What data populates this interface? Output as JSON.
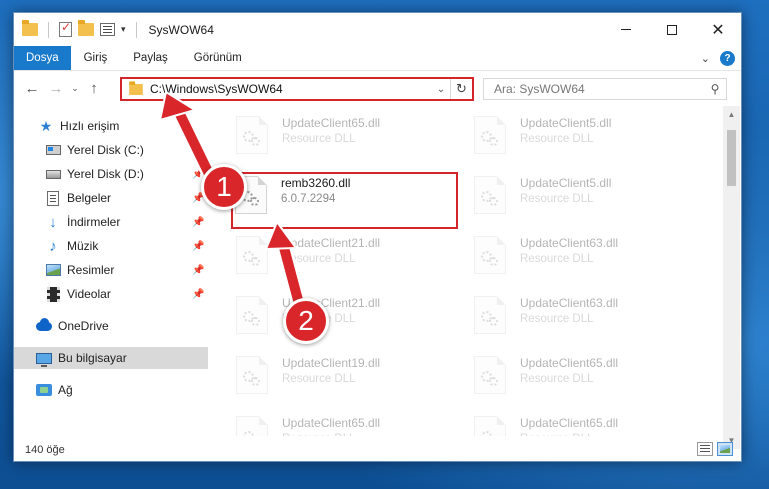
{
  "window": {
    "title": "SysWOW64",
    "dropdown_glyph": "▾",
    "controls": {
      "minimize": "",
      "maximize": "",
      "close": "✕"
    }
  },
  "ribbon": {
    "tabs": [
      "Dosya",
      "Giriş",
      "Paylaş",
      "Görünüm"
    ],
    "expand_glyph": "⌄",
    "help_glyph": "?"
  },
  "nav": {
    "back_glyph": "←",
    "forward_glyph": "→",
    "recent_glyph": "⌄",
    "up_glyph": "↑"
  },
  "address": {
    "path": "C:\\Windows\\SysWOW64",
    "dropdown_glyph": "⌄",
    "refresh_glyph": "↻"
  },
  "search": {
    "placeholder": "Ara: SysWOW64",
    "icon": "search-icon",
    "icon_glyph": "⚲"
  },
  "sidebar": {
    "items": [
      {
        "label": "Hızlı erişim",
        "icon": "star-icon",
        "pinned": false
      },
      {
        "label": "Yerel Disk (C:)",
        "icon": "drive-icon",
        "pinned": false
      },
      {
        "label": "Yerel Disk (D:)",
        "icon": "drive-icon",
        "pinned": true
      },
      {
        "label": "Belgeler",
        "icon": "documents-icon",
        "pinned": true
      },
      {
        "label": "İndirmeler",
        "icon": "downloads-icon",
        "pinned": true
      },
      {
        "label": "Müzik",
        "icon": "music-icon",
        "pinned": true
      },
      {
        "label": "Resimler",
        "icon": "pictures-icon",
        "pinned": true
      },
      {
        "label": "Videolar",
        "icon": "videos-icon",
        "pinned": true
      },
      {
        "label": "OneDrive",
        "icon": "onedrive-icon",
        "pinned": false
      },
      {
        "label": "Bu bilgisayar",
        "icon": "this-pc-icon",
        "pinned": false,
        "selected": true
      },
      {
        "label": "Ağ",
        "icon": "network-icon",
        "pinned": false
      }
    ],
    "pin_glyph": "📌"
  },
  "files": {
    "left_column": [
      {
        "name": "UpdateClient65.dll",
        "type": "Resource DLL",
        "faded": true
      },
      {
        "name": "remb3260.dll",
        "type": "6.0.7.2294",
        "faded": false,
        "highlighted": true
      },
      {
        "name": "UpdateClient21.dll",
        "type": "Resource DLL",
        "faded": true
      },
      {
        "name": "UpdateClient21.dll",
        "type": "Resource DLL",
        "faded": true
      },
      {
        "name": "UpdateClient19.dll",
        "type": "Resource DLL",
        "faded": true
      },
      {
        "name": "UpdateClient65.dll",
        "type": "Resource DLL",
        "faded": true
      }
    ],
    "right_column": [
      {
        "name": "UpdateClient5.dll",
        "type": "Resource DLL",
        "faded": true
      },
      {
        "name": "UpdateClient5.dll",
        "type": "Resource DLL",
        "faded": true
      },
      {
        "name": "UpdateClient63.dll",
        "type": "Resource DLL",
        "faded": true
      },
      {
        "name": "UpdateClient63.dll",
        "type": "Resource DLL",
        "faded": true
      },
      {
        "name": "UpdateClient65.dll",
        "type": "Resource DLL",
        "faded": true
      },
      {
        "name": "UpdateClient65.dll",
        "type": "Resource DLL",
        "faded": true
      }
    ]
  },
  "scrollbar": {
    "up_glyph": "▲",
    "down_glyph": "▼"
  },
  "status": {
    "item_count": "140 öğe"
  },
  "annotations": {
    "step1": "1",
    "step2": "2"
  },
  "colors": {
    "accent": "#1979ca",
    "highlight_red": "#d2262a",
    "badge_red": "#d8262b"
  }
}
